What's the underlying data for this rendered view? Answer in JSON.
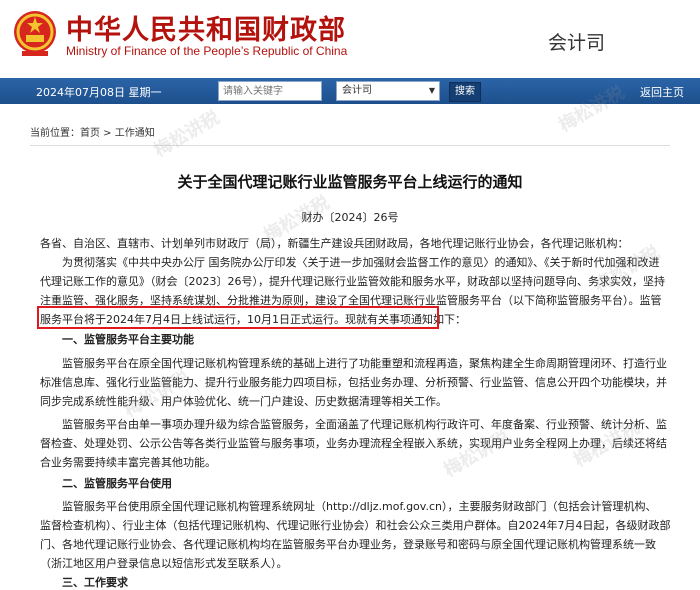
{
  "header": {
    "site_name_cn": "中华人民共和国财政部",
    "site_name_en": "Ministry of Finance of the People’s Republic of China",
    "department": "会计司"
  },
  "navbar": {
    "date": "2024年07月08日 星期一",
    "search_placeholder": "请输入关键字",
    "select_value": "会计司",
    "search_label": "搜索",
    "home_link": "返回主页"
  },
  "breadcrumb": {
    "prefix": "当前位置：",
    "home": "首页",
    "sep": " > ",
    "current": "工作通知"
  },
  "article": {
    "title": "关于全国代理记账行业监管服务平台上线运行的通知",
    "doc_no": "财办〔2024〕26号",
    "lines": [
      "各省、自治区、直辖市、计划单列市财政厅（局），新疆生产建设兵团财政局，各地代理记账行业协会，各代理记账机构：",
      "为贯彻落实《中共中央办公厅 国务院办公厅印发〈关于进一步加强财会监督工作的意见〉的通知》、《关于新时代加强和改进",
      "代理记账工作的意见》（财会〔2023〕26号），提升代理记账行业监管效能和服务水平，财政部以坚持问题导向、务求实效，坚持",
      "注重监管、强化服务，坚持系统谋划、分批推进为原则，建设了全国代理记账行业监管服务平台（以下简称监管服务平台）。监管",
      "服务平台将于2024年7月4日上线试运行，10月1日正式运行。现就有关事项通知如下：",
      "一、监管服务平台主要功能",
      "监管服务平台在原全国代理记账机构管理系统的基础上进行了功能重塑和流程再造，聚焦构建全生命周期管理闭环、打造行业",
      "标准信息库、强化行业监管能力、提升行业服务能力四项目标，包括业务办理、分析预警、行业监管、信息公开四个功能模块，并",
      "同步完成系统性能升级、用户体验优化、统一门户建设、历史数据清理等相关工作。",
      "监管服务平台由单一事项办理升级为综合监管服务，全面涵盖了代理记账机构行政许可、年度备案、行业预警、统计分析、监",
      "督检查、处理处罚、公示公告等各类行业监管与服务事项，业务办理流程全程嵌入系统，实现用户业务全程网上办理，后续还将结",
      "合业务需要持续丰富完善其他功能。",
      "二、监管服务平台使用",
      "监管服务平台使用原全国代理记账机构管理系统网址（http://dljz.mof.gov.cn），主要服务财政部门（包括会计管理机构、",
      "监督检查机构）、行业主体（包括代理记账机构、代理记账行业协会）和社会公众三类用户群体。自2024年7月4日起，各级财政部",
      "门、各地代理记账行业协会、各代理记账机构均在监管服务平台办理业务，登录账号和密码与原全国代理记账机构管理系统一致",
      "（浙江地区用户登录信息以短信形式发至联系人）。",
      "三、工作要求"
    ]
  },
  "watermark": "梅松讲税",
  "colors": {
    "brand_red": "#b3120d",
    "nav_blue": "#2b65a8",
    "highlight_red": "#e0191f"
  }
}
